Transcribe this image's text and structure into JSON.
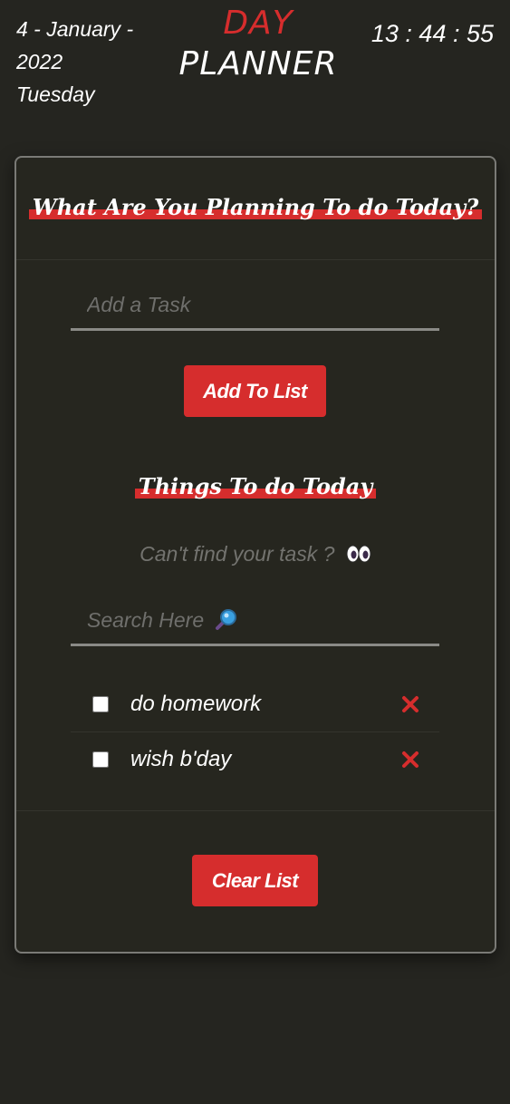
{
  "header": {
    "date_line1": "4 - January -",
    "date_line2": "2022",
    "date_line3": "Tuesday",
    "title_day": "DAY",
    "title_planner": "PLANNER",
    "clock": "13 : 44 : 55"
  },
  "planner": {
    "heading": "What Are You Planning To do Today?",
    "task_input_placeholder": "Add a Task",
    "add_button_label": "Add To List"
  },
  "todo": {
    "heading": "Things To do Today",
    "help_text": "Can't find your task ?",
    "help_icon": "eyes-icon",
    "search_placeholder": "Search Here",
    "search_icon": "magnifier-icon",
    "items": [
      {
        "text": "do homework",
        "checked": false
      },
      {
        "text": "wish b'day",
        "checked": false
      }
    ],
    "clear_button_label": "Clear List"
  },
  "colors": {
    "background": "#252520",
    "accent": "#d62d2d",
    "border": "#7a7a76",
    "placeholder": "#6f6f6c"
  }
}
